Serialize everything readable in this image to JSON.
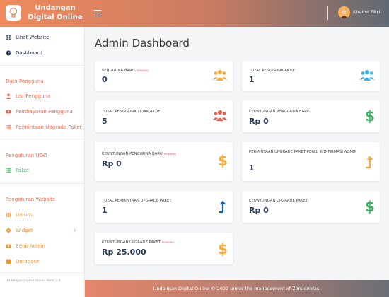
{
  "header": {
    "brand_line1": "Undangan",
    "brand_line2": "Digital Online",
    "user_name": "Khairul Fikri"
  },
  "sidebar": {
    "items_top": [
      {
        "label": "Lihat Website",
        "icon": "globe-icon"
      },
      {
        "label": "Dashboard",
        "icon": "dashboard-icon"
      }
    ],
    "section_pengguna": "Data Pengguna",
    "items_pengguna": [
      {
        "label": "List Pengguna",
        "icon": "user-icon"
      },
      {
        "label": "Pembayaran Pengguna",
        "icon": "money-icon"
      },
      {
        "label": "Permintaan Upgrade Paket",
        "icon": "list-icon"
      }
    ],
    "section_udo": "Pengaturan UDO",
    "items_udo": [
      {
        "label": "Paket",
        "icon": "list-icon"
      }
    ],
    "section_website": "Pengaturan Website",
    "items_website": [
      {
        "label": "Umum",
        "icon": "globe-icon"
      },
      {
        "label": "Widget",
        "icon": "gear-icon"
      },
      {
        "label": "Bank Admin",
        "icon": "money-icon"
      },
      {
        "label": "Database",
        "icon": "database-icon"
      }
    ],
    "footer": "Undangan Digital Online Versi 3.0"
  },
  "main": {
    "title": "Admin Dashboard",
    "cards": [
      {
        "label": "Pengguna Baru",
        "badge": "PENDING",
        "value": "0",
        "icon": "users-icon",
        "color": "#f7a93b"
      },
      {
        "label": "Total Pengguna Aktif",
        "badge": "",
        "value": "1",
        "icon": "users-icon",
        "color": "#3eaee6"
      },
      {
        "label": "Total Pengguna Tidak Aktif",
        "badge": "",
        "value": "5",
        "icon": "users-icon",
        "color": "#ef5a4b"
      },
      {
        "label": "Keuntungan Pengguna Baru",
        "badge": "",
        "value": "Rp 0",
        "icon": "dollar-icon",
        "color": "#3cae5c"
      },
      {
        "label": "Keuntungan Pengguna Baru",
        "badge": "PENDING",
        "value": "Rp 0",
        "icon": "dollar-icon",
        "color": "#f7a93b"
      },
      {
        "label": "Permintaan Upgrade Paket Perlu Konfirmasi Admin",
        "badge": "",
        "value": "1",
        "icon": "arrow-up-icon",
        "color": "#f7a93b"
      },
      {
        "label": "Total Permintaan Upgrade Paket",
        "badge": "",
        "value": "1",
        "icon": "arrow-up-icon",
        "color": "#1f5fae"
      },
      {
        "label": "Keuntungan Upgrade Paket",
        "badge": "",
        "value": "Rp 0",
        "icon": "dollar-icon",
        "color": "#3cae5c"
      },
      {
        "label": "Keuntungan Upgrade Paket",
        "badge": "PENDING",
        "value": "Rp 25.000",
        "icon": "dollar-icon",
        "color": "#f7a93b"
      }
    ]
  },
  "footer": {
    "text": "Undangan Digital Online © 2022 under the management of Zonacerdas."
  },
  "colors": {
    "accent": "#ef6a4c",
    "sidebar_active": "#2a3b5a"
  }
}
